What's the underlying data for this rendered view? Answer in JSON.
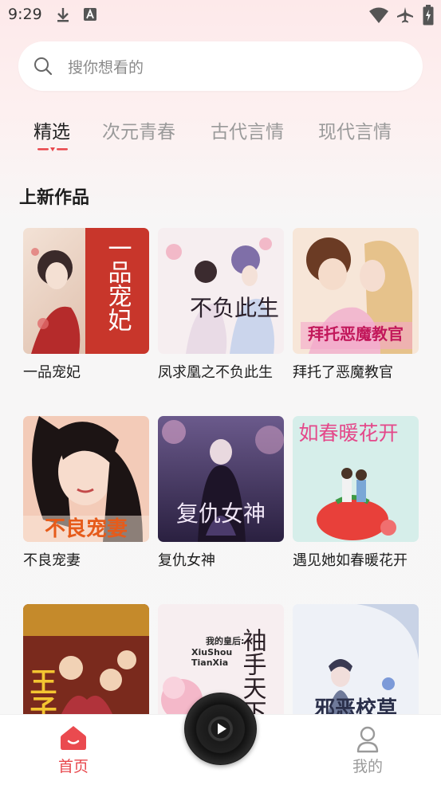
{
  "status_bar": {
    "time": "9:29"
  },
  "search": {
    "placeholder": "搜你想看的"
  },
  "tabs": [
    {
      "label": "精选",
      "active": true
    },
    {
      "label": "次元青春",
      "active": false
    },
    {
      "label": "古代言情",
      "active": false
    },
    {
      "label": "现代言情",
      "active": false
    }
  ],
  "section": {
    "title": "上新作品"
  },
  "books": [
    {
      "title": "一品宠妃",
      "cover_text": "一品宠妃"
    },
    {
      "title": "凤求凰之不负此生",
      "cover_text": "不负此生"
    },
    {
      "title": "拜托了恶魔教官",
      "cover_text": "拜托恶魔教官"
    },
    {
      "title": "不良宠妻",
      "cover_text": "不良宠妻"
    },
    {
      "title": "复仇女神",
      "cover_text": "复仇女神"
    },
    {
      "title": "遇见她如春暖花开",
      "cover_text": "如春暖花开"
    },
    {
      "title": "",
      "cover_text": "王子"
    },
    {
      "title": "",
      "cover_text": "我的皇后: XiuShou TianXia",
      "cover_sub1": "我的皇后:",
      "cover_sub2": "XiuShou",
      "cover_sub3": "TianXia",
      "cover_big": "袖手天下"
    },
    {
      "title": "",
      "cover_text": "邪恶校草"
    }
  ],
  "bottom_nav": {
    "home_label": "首页",
    "mine_label": "我的"
  },
  "colors": {
    "accent": "#e8474c",
    "inactive": "#9a9a9a"
  }
}
